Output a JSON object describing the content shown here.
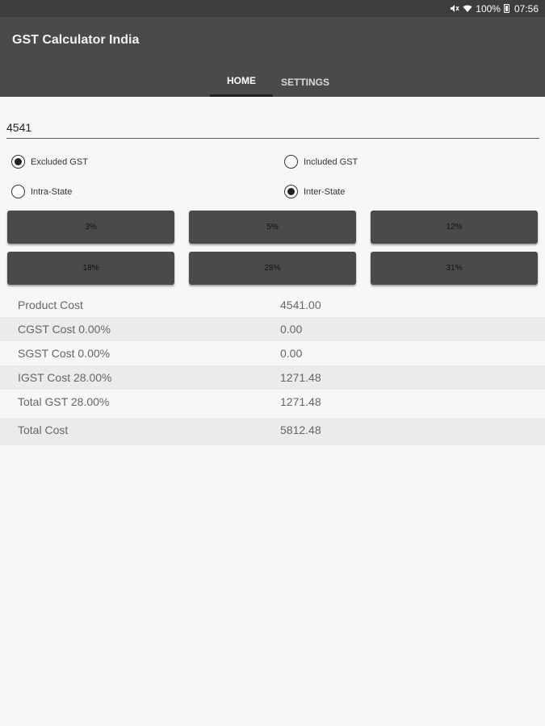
{
  "status_bar": {
    "battery_text": "100%",
    "time": "07:56"
  },
  "app_bar": {
    "title": "GST Calculator India",
    "tabs": [
      {
        "label": "HOME",
        "selected": true
      },
      {
        "label": "SETTINGS",
        "selected": false
      }
    ]
  },
  "form": {
    "amount_value": "4541",
    "gst_mode": {
      "excluded_label": "Excluded GST",
      "included_label": "Included GST",
      "selected": "Excluded GST"
    },
    "state_mode": {
      "intra_label": "Intra-State",
      "inter_label": "Inter-State",
      "selected": "Inter-State"
    },
    "rates": [
      "3%",
      "5%",
      "12%",
      "18%",
      "28%",
      "31%"
    ]
  },
  "results": [
    {
      "label": "Product Cost",
      "value": "4541.00"
    },
    {
      "label": "CGST Cost 0.00%",
      "value": "0.00"
    },
    {
      "label": "SGST Cost 0.00%",
      "value": "0.00"
    },
    {
      "label": "IGST Cost 28.00%",
      "value": "1271.48"
    },
    {
      "label": "Total GST 28.00%",
      "value": "1271.48"
    },
    {
      "label": "Total Cost",
      "value": "5812.48"
    }
  ],
  "colors": {
    "app_bar": "#4a494c",
    "status_bar": "#3d3d3f",
    "button": "#4a494c",
    "background": "#f7f7f7"
  }
}
